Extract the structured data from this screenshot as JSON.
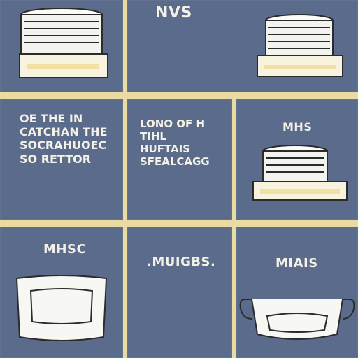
{
  "panels": {
    "p2": {
      "label": "NVS"
    },
    "p4": {
      "lines": [
        "OE THE IN",
        "CATCHAN THE",
        "SOCRAHUOEC",
        "SO RETTOR"
      ]
    },
    "p5": {
      "lines": [
        "LONO OF H",
        "TIHL",
        "HUFTAIS",
        "SFEALCAGG"
      ]
    },
    "p6": {
      "label": "MHS"
    },
    "p7": {
      "label": "MHSC"
    },
    "p8": {
      "label": ".MUIGBS."
    },
    "p9": {
      "label": "MIAIS"
    }
  },
  "colors": {
    "panel": "#5a6b8c",
    "border": "#e9dca0",
    "ink": "#f4f1e6",
    "accent": "#f1df9b"
  }
}
